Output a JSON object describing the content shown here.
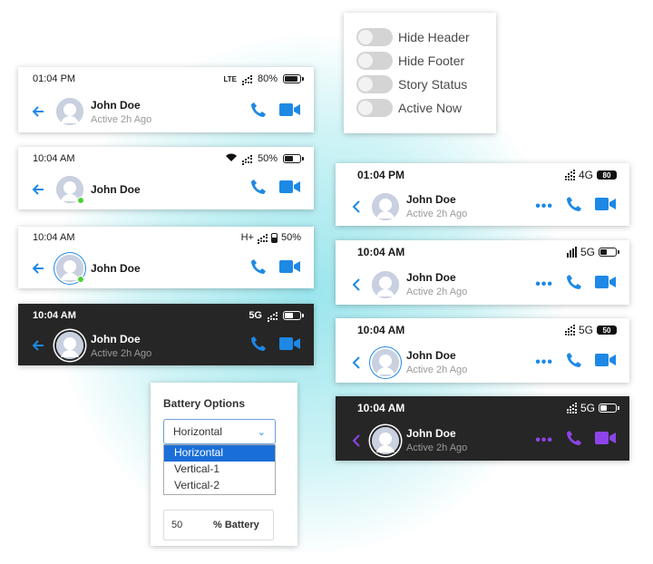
{
  "toggles": [
    {
      "label": "Hide Header",
      "on": false
    },
    {
      "label": "Hide Footer",
      "on": false
    },
    {
      "label": "Story Status",
      "on": false
    },
    {
      "label": "Active Now",
      "on": false
    }
  ],
  "headers_left": [
    {
      "time": "01:04 PM",
      "network": "LTE",
      "battery": "80%",
      "name": "John Doe",
      "status": "Active 2h Ago"
    },
    {
      "time": "10:04 AM",
      "battery": "50%",
      "name": "John Doe"
    },
    {
      "time": "10:04 AM",
      "network": "H+",
      "battery": "50%",
      "name": "John Doe"
    },
    {
      "time": "10:04 AM",
      "network": "5G",
      "name": "John Doe",
      "status": "Active 2h Ago"
    }
  ],
  "headers_right": [
    {
      "time": "01:04 PM",
      "network": "4G",
      "battery": "80",
      "name": "John Doe",
      "status": "Active 2h Ago"
    },
    {
      "time": "10:04 AM",
      "network": "5G",
      "name": "John Doe",
      "status": "Active 2h Ago"
    },
    {
      "time": "10:04 AM",
      "network": "5G",
      "battery": "50",
      "name": "John Doe",
      "status": "Active 2h Ago"
    },
    {
      "time": "10:04 AM",
      "network": "5G",
      "name": "John Doe",
      "status": "Active 2h Ago"
    }
  ],
  "icons": {
    "back": "back-arrow-icon",
    "phone": "phone-icon",
    "video": "video-camera-icon",
    "more": "more-dots-icon",
    "wifi": "wifi-icon",
    "signal": "signal-icon",
    "battery": "battery-icon"
  },
  "colors": {
    "accent": "#1e88e5",
    "accent_dark_variant": "#8e44e8",
    "online": "#4cd137",
    "dark_bg": "#262626"
  },
  "battery_options": {
    "title": "Battery Options",
    "selected": "Horizontal",
    "options": [
      "Horizontal",
      "Vertical-1",
      "Vertical-2"
    ],
    "percent_value": "50",
    "percent_label": "% Battery"
  }
}
